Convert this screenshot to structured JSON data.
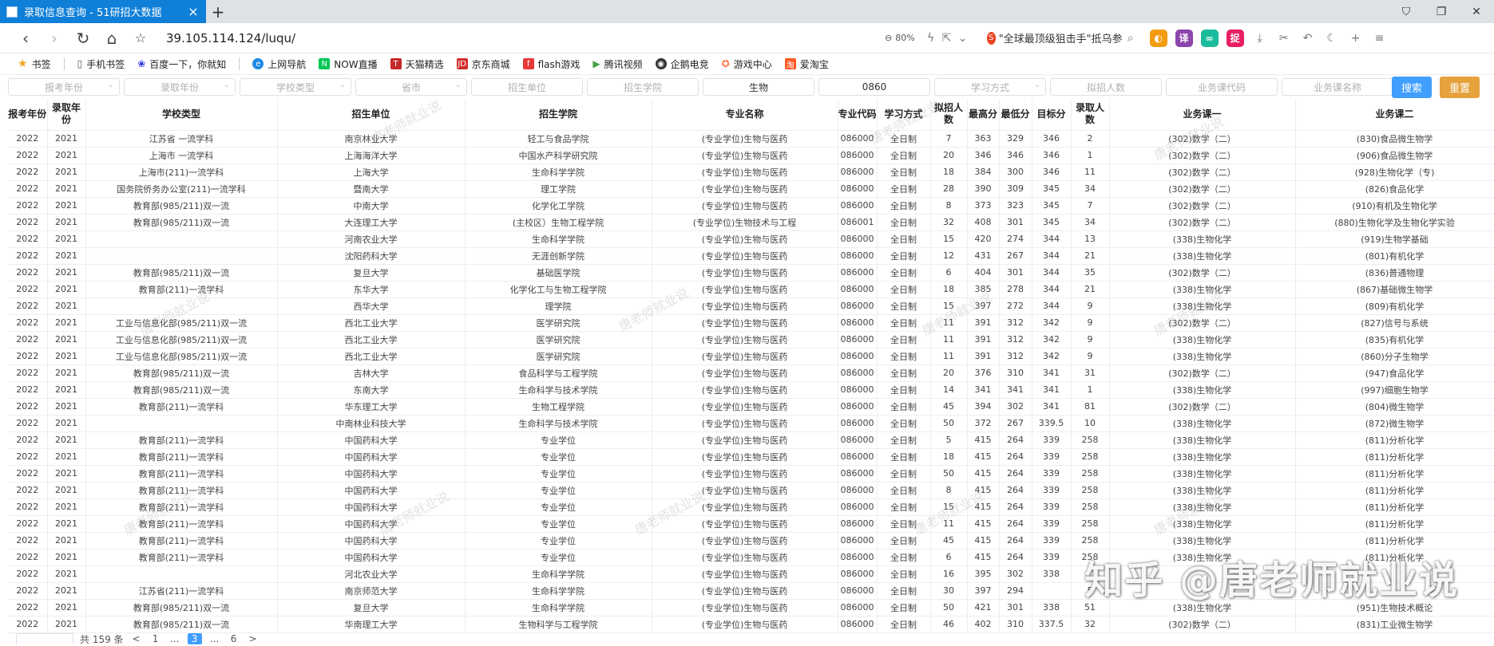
{
  "browser": {
    "tab_title": "录取信息查询 - 51研招大数据",
    "new_tab": "+",
    "url": "39.105.114.124/luqu/",
    "zoom": "80%",
    "news_text": "\"全球最顶级狙击手\"抵乌参",
    "bookmarks": [
      "书签",
      "手机书签",
      "百度一下，你就知",
      "上网导航",
      "NOW直播",
      "天猫精选",
      "京东商城",
      "flash游戏",
      "腾讯视频",
      "企鹅电竞",
      "游戏中心",
      "爱淘宝"
    ]
  },
  "filters": {
    "report_year": "报考年份",
    "admit_year": "录取年份",
    "school_type": "学校类型",
    "province": "省市",
    "unit": "招生单位",
    "college": "招生学院",
    "major_name": "生物",
    "major_code": "0860",
    "study_mode": "学习方式",
    "planned": "拟招人数",
    "course_code": "业务课代码",
    "course_name": "业务课名称",
    "search_btn": "搜索",
    "reset_btn": "重置"
  },
  "table": {
    "headers": [
      "报考年份",
      "录取年份",
      "学校类型",
      "招生单位",
      "招生学院",
      "专业名称",
      "专业代码",
      "学习方式",
      "拟招人数",
      "最高分",
      "最低分",
      "目标分",
      "录取人数",
      "业务课一",
      "业务课二"
    ],
    "rows": [
      [
        "2022",
        "2021",
        "江苏省 一流学科",
        "南京林业大学",
        "轻工与食品学院",
        "(专业学位)生物与医药",
        "086000",
        "全日制",
        "7",
        "363",
        "329",
        "346",
        "2",
        "(302)数学（二）",
        "(830)食品微生物学"
      ],
      [
        "2022",
        "2021",
        "上海市 一流学科",
        "上海海洋大学",
        "中国水产科学研究院",
        "(专业学位)生物与医药",
        "086000",
        "全日制",
        "20",
        "346",
        "346",
        "346",
        "1",
        "(302)数学（二）",
        "(906)食品微生物学"
      ],
      [
        "2022",
        "2021",
        "上海市(211)一流学科",
        "上海大学",
        "生命科学学院",
        "(专业学位)生物与医药",
        "086000",
        "全日制",
        "18",
        "384",
        "300",
        "346",
        "11",
        "(302)数学（二）",
        "(928)生物化学（专)"
      ],
      [
        "2022",
        "2021",
        "国务院侨务办公室(211)一流学科",
        "暨南大学",
        "理工学院",
        "(专业学位)生物与医药",
        "086000",
        "全日制",
        "28",
        "390",
        "309",
        "345",
        "34",
        "(302)数学（二）",
        "(826)食品化学"
      ],
      [
        "2022",
        "2021",
        "教育部(985/211)双一流",
        "中南大学",
        "化学化工学院",
        "(专业学位)生物与医药",
        "086000",
        "全日制",
        "8",
        "373",
        "323",
        "345",
        "7",
        "(302)数学（二）",
        "(910)有机及生物化学"
      ],
      [
        "2022",
        "2021",
        "教育部(985/211)双一流",
        "大连理工大学",
        "(主校区）生物工程学院",
        "(专业学位)生物技术与工程",
        "086001",
        "全日制",
        "32",
        "408",
        "301",
        "345",
        "34",
        "(302)数学（二）",
        "(880)生物化学及生物化学实验"
      ],
      [
        "2022",
        "2021",
        "",
        "河南农业大学",
        "生命科学学院",
        "(专业学位)生物与医药",
        "086000",
        "全日制",
        "15",
        "420",
        "274",
        "344",
        "13",
        "(338)生物化学",
        "(919)生物学基础"
      ],
      [
        "2022",
        "2021",
        "",
        "沈阳药科大学",
        "无涯创新学院",
        "(专业学位)生物与医药",
        "086000",
        "全日制",
        "12",
        "431",
        "267",
        "344",
        "21",
        "(338)生物化学",
        "(801)有机化学"
      ],
      [
        "2022",
        "2021",
        "教育部(985/211)双一流",
        "复旦大学",
        "基础医学院",
        "(专业学位)生物与医药",
        "086000",
        "全日制",
        "6",
        "404",
        "301",
        "344",
        "35",
        "(302)数学（二）",
        "(836)普通物理"
      ],
      [
        "2022",
        "2021",
        "教育部(211)一流学科",
        "东华大学",
        "化学化工与生物工程学院",
        "(专业学位)生物与医药",
        "086000",
        "全日制",
        "18",
        "385",
        "278",
        "344",
        "21",
        "(338)生物化学",
        "(867)基础微生物学"
      ],
      [
        "2022",
        "2021",
        "",
        "西华大学",
        "理学院",
        "(专业学位)生物与医药",
        "086000",
        "全日制",
        "15",
        "397",
        "272",
        "344",
        "9",
        "(338)生物化学",
        "(809)有机化学"
      ],
      [
        "2022",
        "2021",
        "工业与信息化部(985/211)双一流",
        "西北工业大学",
        "医学研究院",
        "(专业学位)生物与医药",
        "086000",
        "全日制",
        "11",
        "391",
        "312",
        "342",
        "9",
        "(302)数学（二）",
        "(827)信号与系统"
      ],
      [
        "2022",
        "2021",
        "工业与信息化部(985/211)双一流",
        "西北工业大学",
        "医学研究院",
        "(专业学位)生物与医药",
        "086000",
        "全日制",
        "11",
        "391",
        "312",
        "342",
        "9",
        "(338)生物化学",
        "(835)有机化学"
      ],
      [
        "2022",
        "2021",
        "工业与信息化部(985/211)双一流",
        "西北工业大学",
        "医学研究院",
        "(专业学位)生物与医药",
        "086000",
        "全日制",
        "11",
        "391",
        "312",
        "342",
        "9",
        "(338)生物化学",
        "(860)分子生物学"
      ],
      [
        "2022",
        "2021",
        "教育部(985/211)双一流",
        "吉林大学",
        "食品科学与工程学院",
        "(专业学位)生物与医药",
        "086000",
        "全日制",
        "20",
        "376",
        "310",
        "341",
        "31",
        "(302)数学（二）",
        "(947)食品化学"
      ],
      [
        "2022",
        "2021",
        "教育部(985/211)双一流",
        "东南大学",
        "生命科学与技术学院",
        "(专业学位)生物与医药",
        "086000",
        "全日制",
        "14",
        "341",
        "341",
        "341",
        "1",
        "(338)生物化学",
        "(997)细胞生物学"
      ],
      [
        "2022",
        "2021",
        "教育部(211)一流学科",
        "华东理工大学",
        "生物工程学院",
        "(专业学位)生物与医药",
        "086000",
        "全日制",
        "45",
        "394",
        "302",
        "341",
        "81",
        "(302)数学（二）",
        "(804)微生物学"
      ],
      [
        "2022",
        "2021",
        "",
        "中南林业科技大学",
        "生命科学与技术学院",
        "(专业学位)生物与医药",
        "086000",
        "全日制",
        "50",
        "372",
        "267",
        "339.5",
        "10",
        "(338)生物化学",
        "(872)微生物学"
      ],
      [
        "2022",
        "2021",
        "教育部(211)一流学科",
        "中国药科大学",
        "专业学位",
        "(专业学位)生物与医药",
        "086000",
        "全日制",
        "5",
        "415",
        "264",
        "339",
        "258",
        "(338)生物化学",
        "(811)分析化学"
      ],
      [
        "2022",
        "2021",
        "教育部(211)一流学科",
        "中国药科大学",
        "专业学位",
        "(专业学位)生物与医药",
        "086000",
        "全日制",
        "18",
        "415",
        "264",
        "339",
        "258",
        "(338)生物化学",
        "(811)分析化学"
      ],
      [
        "2022",
        "2021",
        "教育部(211)一流学科",
        "中国药科大学",
        "专业学位",
        "(专业学位)生物与医药",
        "086000",
        "全日制",
        "50",
        "415",
        "264",
        "339",
        "258",
        "(338)生物化学",
        "(811)分析化学"
      ],
      [
        "2022",
        "2021",
        "教育部(211)一流学科",
        "中国药科大学",
        "专业学位",
        "(专业学位)生物与医药",
        "086000",
        "全日制",
        "8",
        "415",
        "264",
        "339",
        "258",
        "(338)生物化学",
        "(811)分析化学"
      ],
      [
        "2022",
        "2021",
        "教育部(211)一流学科",
        "中国药科大学",
        "专业学位",
        "(专业学位)生物与医药",
        "086000",
        "全日制",
        "15",
        "415",
        "264",
        "339",
        "258",
        "(338)生物化学",
        "(811)分析化学"
      ],
      [
        "2022",
        "2021",
        "教育部(211)一流学科",
        "中国药科大学",
        "专业学位",
        "(专业学位)生物与医药",
        "086000",
        "全日制",
        "11",
        "415",
        "264",
        "339",
        "258",
        "(338)生物化学",
        "(811)分析化学"
      ],
      [
        "2022",
        "2021",
        "教育部(211)一流学科",
        "中国药科大学",
        "专业学位",
        "(专业学位)生物与医药",
        "086000",
        "全日制",
        "45",
        "415",
        "264",
        "339",
        "258",
        "(338)生物化学",
        "(811)分析化学"
      ],
      [
        "2022",
        "2021",
        "教育部(211)一流学科",
        "中国药科大学",
        "专业学位",
        "(专业学位)生物与医药",
        "086000",
        "全日制",
        "6",
        "415",
        "264",
        "339",
        "258",
        "(338)生物化学",
        "(811)分析化学"
      ],
      [
        "2022",
        "2021",
        "",
        "河北农业大学",
        "生命科学学院",
        "(专业学位)生物与医药",
        "086000",
        "全日制",
        "16",
        "395",
        "302",
        "338",
        "",
        "",
        ""
      ],
      [
        "2022",
        "2021",
        "江苏省(211)一流学科",
        "南京师范大学",
        "生命科学学院",
        "(专业学位)生物与医药",
        "086000",
        "全日制",
        "30",
        "397",
        "294",
        "",
        "5",
        "",
        ""
      ],
      [
        "2022",
        "2021",
        "教育部(985/211)双一流",
        "复旦大学",
        "生命科学学院",
        "(专业学位)生物与医药",
        "086000",
        "全日制",
        "50",
        "421",
        "301",
        "338",
        "51",
        "(338)生物化学",
        "(951)生物技术概论"
      ],
      [
        "2022",
        "2021",
        "教育部(985/211)双一流",
        "华南理工大学",
        "生物科学与工程学院",
        "(专业学位)生物与医药",
        "086000",
        "全日制",
        "46",
        "402",
        "310",
        "337.5",
        "32",
        "(302)数学（二）",
        "(831)工业微生物学"
      ]
    ]
  },
  "pagination": {
    "total": "共 159 条",
    "prev": "<",
    "pages": [
      "1",
      "...",
      "3",
      "...",
      "6"
    ],
    "next": ">"
  },
  "watermark": "唐老师就业说",
  "zhihu_watermark": "知乎 @唐老师就业说",
  "colors": {
    "tab": "#0f7fd8",
    "search": "#409eff",
    "reset": "#e6a23c"
  }
}
